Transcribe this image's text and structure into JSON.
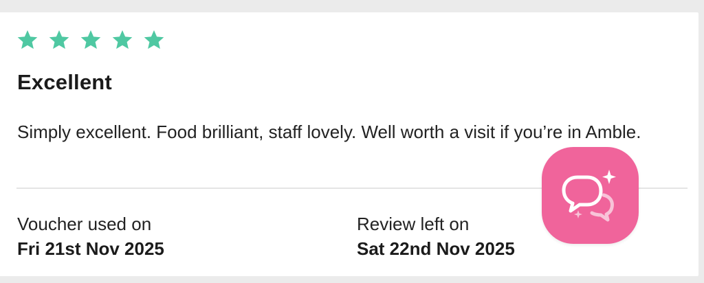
{
  "review": {
    "rating": 5,
    "max_rating": 5,
    "star_color": "#4fc8a2",
    "title": "Excellent",
    "text": "Simply excellent. Food brilliant, staff lovely. Well worth a visit if you’re in Amble."
  },
  "voucher": {
    "label": "Voucher used on",
    "date": "Fri 21st Nov 2025"
  },
  "review_left": {
    "label": "Review left on",
    "date": "Sat 22nd Nov 2025"
  },
  "chat_button": {
    "icon": "chat-sparkle-icon",
    "color": "#f0649b"
  }
}
